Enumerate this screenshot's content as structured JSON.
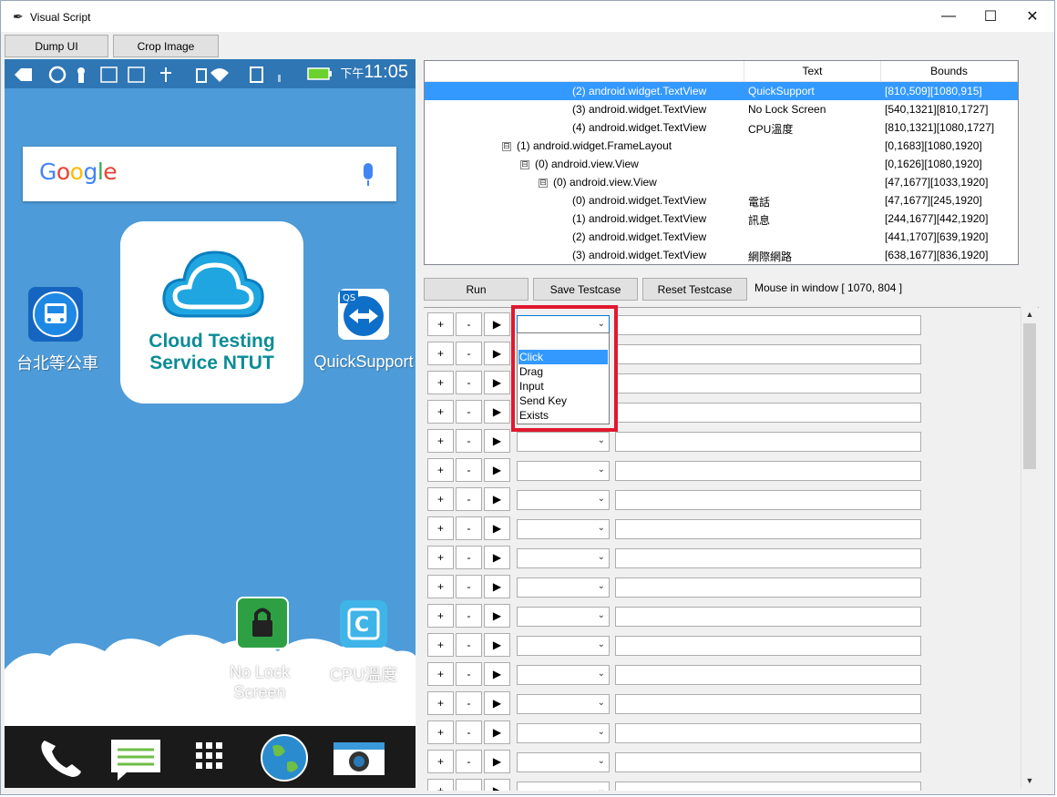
{
  "window": {
    "title": "Visual Script",
    "controls": {
      "minimize": "—",
      "maximize": "☐",
      "close": "✕"
    }
  },
  "toolbar": {
    "dump_label": "Dump UI",
    "crop_label": "Crop Image"
  },
  "phone": {
    "clock_prefix": "下午",
    "clock": "11:05",
    "google": "Google",
    "center_app": {
      "line1": "Cloud Testing",
      "line2": "Service NTUT"
    },
    "apps": [
      {
        "label": "台北等公車"
      },
      {
        "label": "QuickSupport"
      },
      {
        "label": "No Lock\nScreen"
      },
      {
        "label": "CPU溫度"
      }
    ]
  },
  "tree": {
    "columns": [
      "",
      "Text",
      "Bounds"
    ],
    "rows": [
      {
        "node": "(2) android.widget.TextView",
        "text": "QuickSupport",
        "bounds": "[810,509][1080,915]",
        "selected": true
      },
      {
        "node": "(3) android.widget.TextView",
        "text": "No Lock Screen",
        "bounds": "[540,1321][810,1727]"
      },
      {
        "node": "(4) android.widget.TextView",
        "text": "CPU溫度",
        "bounds": "[810,1321][1080,1727]"
      },
      {
        "node": "(1) android.widget.FrameLayout",
        "text": "",
        "bounds": "[0,1683][1080,1920]",
        "expander": "⊟"
      },
      {
        "node": "(0) android.view.View",
        "text": "",
        "bounds": "[0,1626][1080,1920]",
        "expander": "⊟"
      },
      {
        "node": "(0) android.view.View",
        "text": "",
        "bounds": "[47,1677][1033,1920]",
        "expander": "⊟"
      },
      {
        "node": "(0) android.widget.TextView",
        "text": "電話",
        "bounds": "[47,1677][245,1920]"
      },
      {
        "node": "(1) android.widget.TextView",
        "text": "訊息",
        "bounds": "[244,1677][442,1920]"
      },
      {
        "node": "(2) android.widget.TextView",
        "text": "",
        "bounds": "[441,1707][639,1920]"
      },
      {
        "node": "(3) android.widget.TextView",
        "text": "網際網路",
        "bounds": "[638,1677][836,1920]"
      }
    ]
  },
  "controls": {
    "run_label": "Run",
    "save_label": "Save Testcase",
    "reset_label": "Reset Testcase",
    "mouse_text": "Mouse in window [ 1070, 804 ]"
  },
  "steps": {
    "plus": "+",
    "minus": "-",
    "play": "▶",
    "arrow": "⌄",
    "row_count": 17
  },
  "dropdown": {
    "options": [
      "Click",
      "Drag",
      "Input",
      "Send Key",
      "Exists"
    ],
    "selected": "Click"
  },
  "scrollbar": {
    "up": "▲",
    "down": "▼"
  }
}
